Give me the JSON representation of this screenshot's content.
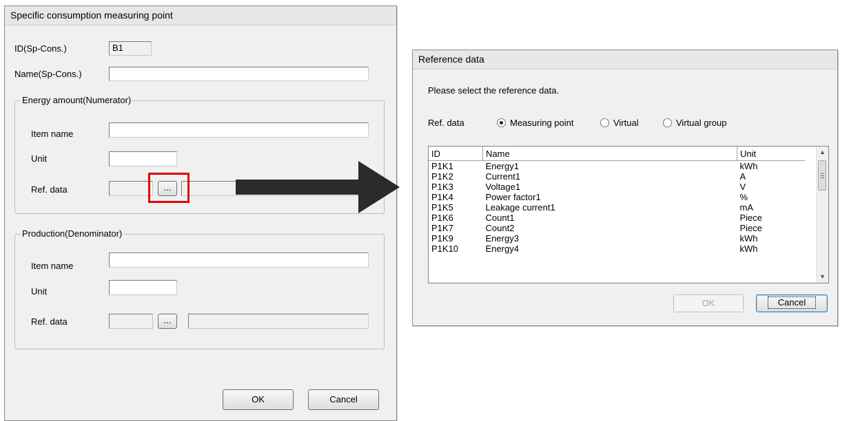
{
  "left_dialog": {
    "title": "Specific consumption measuring point",
    "id_label": "ID(Sp-Cons.)",
    "id_value": "B1",
    "name_label": "Name(Sp-Cons.)",
    "name_value": "",
    "numerator": {
      "legend": "Energy amount(Numerator)",
      "item_name_label": "Item name",
      "item_name_value": "",
      "unit_label": "Unit",
      "unit_value": "",
      "ref_label": "Ref. data",
      "browse_label": "..."
    },
    "denominator": {
      "legend": "Production(Denominator)",
      "item_name_label": "Item name",
      "item_name_value": "",
      "unit_label": "Unit",
      "unit_value": "",
      "ref_label": "Ref. data",
      "browse_label": "..."
    },
    "ok_label": "OK",
    "cancel_label": "Cancel"
  },
  "right_dialog": {
    "title": "Reference data",
    "prompt": "Please select the reference data.",
    "ref_label": "Ref. data",
    "radios": [
      {
        "label": "Measuring point",
        "selected": true
      },
      {
        "label": "Virtual",
        "selected": false
      },
      {
        "label": "Virtual group",
        "selected": false
      }
    ],
    "columns": [
      "ID",
      "Name",
      "Unit"
    ],
    "rows": [
      [
        "P1K1",
        "Energy1",
        "kWh"
      ],
      [
        "P1K2",
        "Current1",
        "A"
      ],
      [
        "P1K3",
        "Voltage1",
        "V"
      ],
      [
        "P1K4",
        "Power factor1",
        "%"
      ],
      [
        "P1K5",
        "Leakage current1",
        "mA"
      ],
      [
        "P1K6",
        "Count1",
        "Piece"
      ],
      [
        "P1K7",
        "Count2",
        "Piece"
      ],
      [
        "P1K9",
        "Energy3",
        "kWh"
      ],
      [
        "P1K10",
        "Energy4",
        "kWh"
      ]
    ],
    "ok_label": "OK",
    "cancel_label": "Cancel"
  },
  "colors": {
    "highlight": "#e00000",
    "arrow": "#2b2b2b",
    "dialog_bg": "#f0f0f0"
  }
}
